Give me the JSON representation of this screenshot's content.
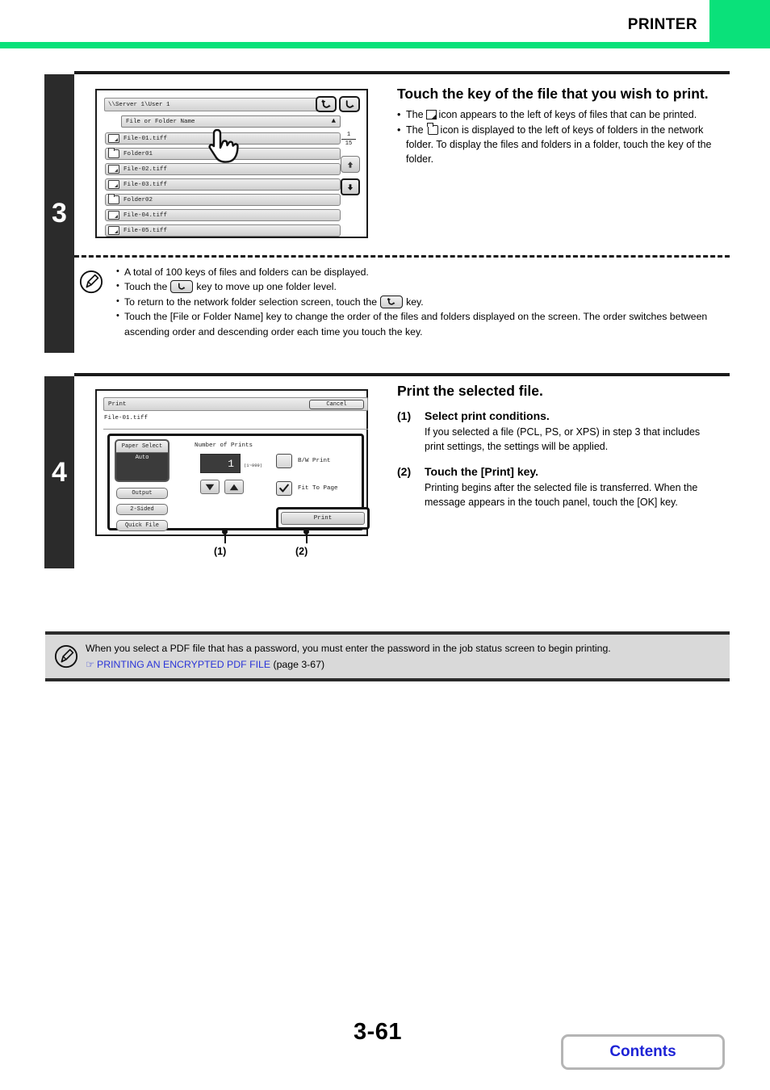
{
  "header": {
    "title": "PRINTER",
    "accent_color": "#0ae17a"
  },
  "steps": [
    {
      "number": "3",
      "heading": "Touch the key of the file that you wish to print.",
      "bullets": [
        {
          "before": "The",
          "icon": "file-icon",
          "after": "icon appears to the left of keys of files that can be printed."
        },
        {
          "before": "The",
          "icon": "folder-icon",
          "after": "icon is displayed to the left of keys of folders in the network folder. To display the files and folders in a folder, touch the key of the folder."
        }
      ],
      "screen": {
        "path": "\\\\Server 1\\User 1",
        "sort_key_label": "File or Folder Name",
        "sort_arrow": "▲",
        "nav_root_icon": "return-to-root-icon",
        "nav_up_icon": "move-up-folder-icon",
        "page_current": "1",
        "page_total": "15",
        "rows": [
          {
            "type": "file",
            "name": "File-01.tiff"
          },
          {
            "type": "folder",
            "name": "Folder01"
          },
          {
            "type": "file",
            "name": "File-02.tiff"
          },
          {
            "type": "file",
            "name": "File-03.tiff"
          },
          {
            "type": "folder",
            "name": "Folder02"
          },
          {
            "type": "file",
            "name": "File-04.tiff"
          },
          {
            "type": "file",
            "name": "File-05.tiff"
          }
        ]
      }
    },
    {
      "number": "4",
      "heading": "Print the selected file.",
      "substeps": [
        {
          "label": "(1)",
          "title": "Select print conditions.",
          "body": "If you selected a file (PCL, PS, or XPS) in step 3 that includes print settings, the settings will be applied."
        },
        {
          "label": "(2)",
          "title": "Touch the [Print] key.",
          "body": "Printing begins after the selected file is transferred. When the message appears in the touch panel, touch the [OK] key."
        }
      ],
      "screen": {
        "title": "Print",
        "cancel_label": "Cancel",
        "file_name": "File-01.tiff",
        "paper_select_label": "Paper Select",
        "paper_select_value": "Auto",
        "output_label": "Output",
        "two_sided_label": "2-Sided",
        "quick_file_label": "Quick File",
        "number_of_prints_label": "Number of Prints",
        "number_of_prints_value": "1",
        "number_of_prints_range": "(1~999)",
        "bw_print_label": "B/W Print",
        "bw_print_checked": false,
        "fit_to_page_label": "Fit To Page",
        "fit_to_page_checked": true,
        "print_label": "Print"
      },
      "callouts": [
        "(1)",
        "(2)"
      ]
    }
  ],
  "note_step3": {
    "icon": "pencil-note-icon",
    "items": [
      {
        "text_before": "A total of 100 keys of files and folders can be displayed.",
        "key": null,
        "text_after": ""
      },
      {
        "text_before": "Touch the",
        "key": "move-up-folder-icon",
        "text_after": "key to move up one folder level."
      },
      {
        "text_before": "To return to the network folder selection screen, touch the",
        "key": "return-to-root-icon",
        "text_after": "key."
      },
      {
        "text_before": "Touch the [File or Folder Name] key to change the order of the files and folders displayed on the screen. The order switches between ascending order and descending order each time you touch the key.",
        "key": null,
        "text_after": ""
      }
    ]
  },
  "note_bottom": {
    "icon": "pencil-note-icon",
    "text": "When you select a PDF file that has a password, you must enter the password in the job status screen to begin printing.",
    "link_marker": "☞",
    "link_text": "PRINTING AN ENCRYPTED PDF FILE",
    "link_suffix": "(page 3-67)"
  },
  "footer": {
    "page_number": "3-61",
    "contents_label": "Contents"
  }
}
